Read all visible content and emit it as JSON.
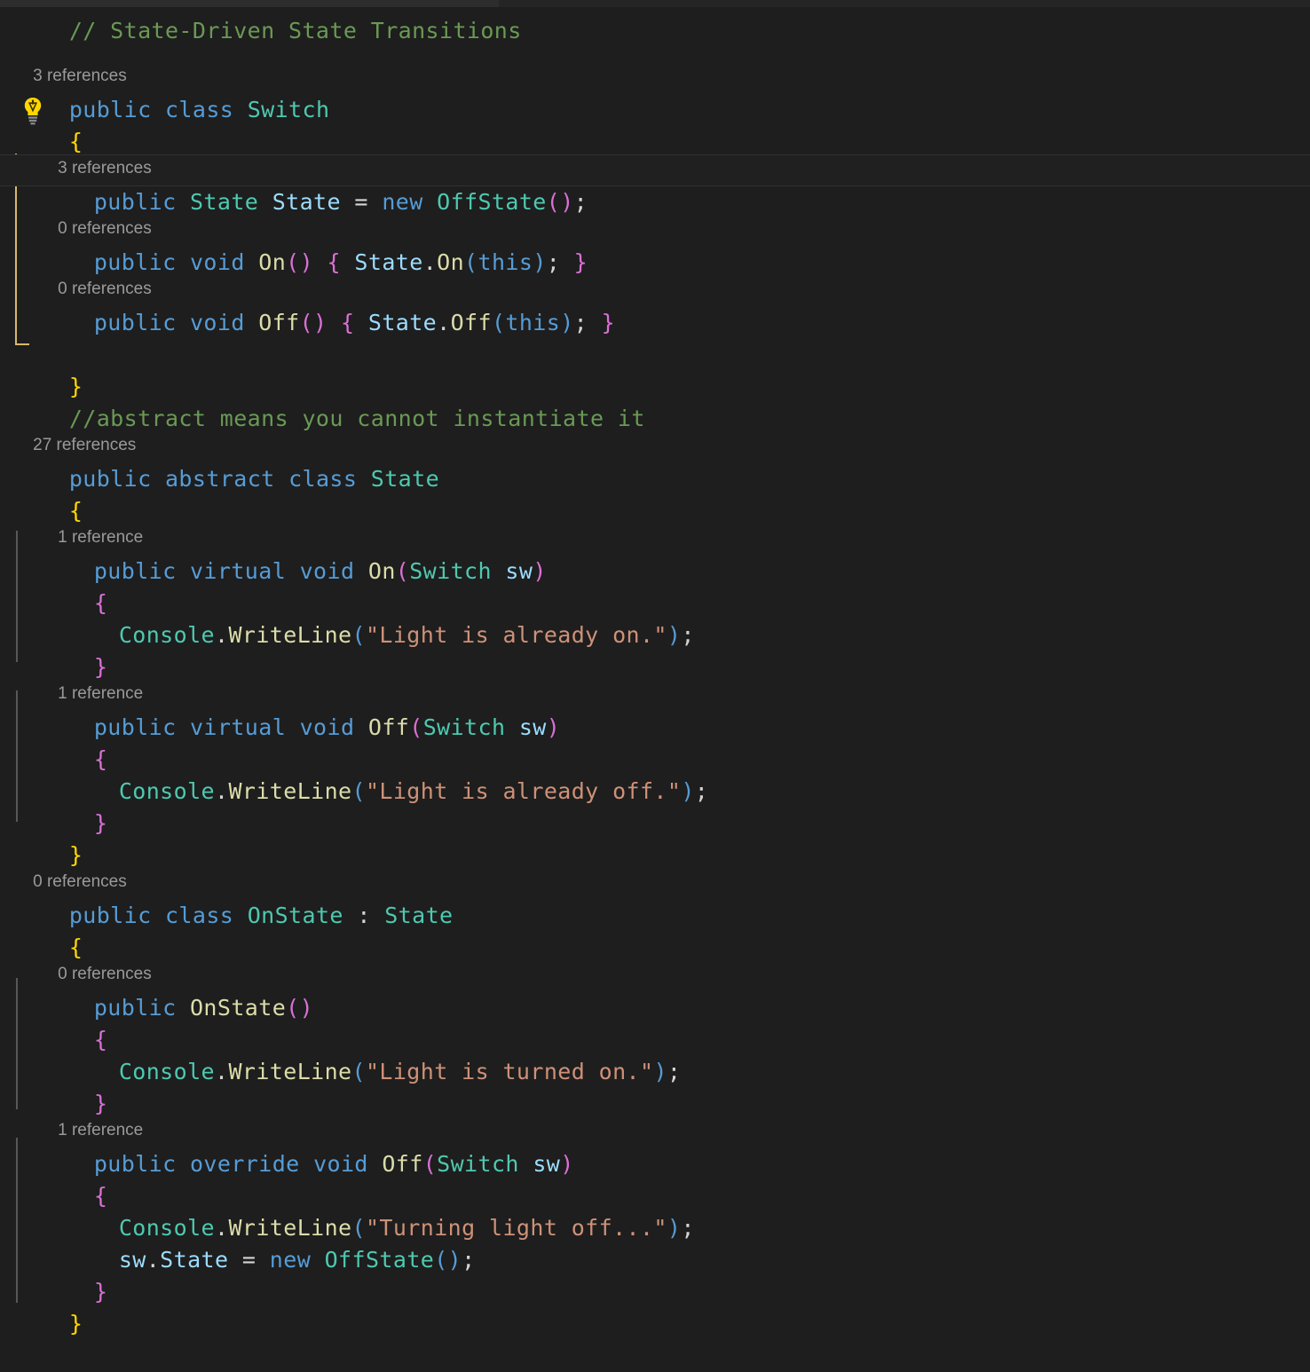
{
  "app": {
    "kind": "code-editor",
    "language": "csharp",
    "theme": "dark-plus"
  },
  "colors": {
    "background": "#1e1e1e",
    "current_line": "#202020",
    "keyword": "#569cd6",
    "type": "#4ec9b0",
    "function": "#dcdcaa",
    "string": "#ce9178",
    "comment": "#6a9955",
    "identifier": "#9cdcfe",
    "brace_magenta": "#da70d6",
    "brace_yellow": "#ffd700",
    "codelens": "#9a9a9a",
    "indent_guide": "#585858",
    "indent_guide_active": "#d7ba6a",
    "lightbulb": "#ffd700"
  },
  "icons": {
    "lightbulb": "lightbulb-icon"
  },
  "codelens": {
    "switch_class": "3 references",
    "switch_state_field": "3 references",
    "switch_on_method": "0 references",
    "switch_off_method": "0 references",
    "state_class": "27 references",
    "state_on_method": "1 reference",
    "state_off_method": "1 reference",
    "onstate_class": "0 references",
    "onstate_ctor": "0 references",
    "onstate_off_method": "1 reference"
  },
  "code": {
    "header_comment": "// State-Driven State Transitions",
    "abstract_comment": "//abstract means you cannot instantiate it",
    "switch_decl": {
      "public": "public",
      "class": "class",
      "name": "Switch"
    },
    "switch_open_brace": "{",
    "switch_close_brace": "}",
    "state_field": {
      "public": "public",
      "type": "State",
      "name": "State",
      "equals": "=",
      "new": "new",
      "ctor": "OffState",
      "parens": "()",
      "semi": ";"
    },
    "switch_on": {
      "public": "public",
      "void": "void",
      "name": "On",
      "parens": "()",
      "open": "{",
      "target": "State",
      "dot": ".",
      "call": "On",
      "lparen": "(",
      "arg": "this",
      "rparen": ")",
      "semi": ";",
      "close": "}"
    },
    "switch_off": {
      "public": "public",
      "void": "void",
      "name": "Off",
      "parens": "()",
      "open": "{",
      "target": "State",
      "dot": ".",
      "call": "Off",
      "lparen": "(",
      "arg": "this",
      "rparen": ")",
      "semi": ";",
      "close": "}"
    },
    "state_decl": {
      "public": "public",
      "abstract": "abstract",
      "class": "class",
      "name": "State"
    },
    "state_open_brace": "{",
    "state_close_brace": "}",
    "state_on": {
      "public": "public",
      "virtual": "virtual",
      "void": "void",
      "name": "On",
      "lparen": "(",
      "param_type": "Switch",
      "param_name": "sw",
      "rparen": ")",
      "open": "{",
      "close": "}",
      "body": {
        "console": "Console",
        "dot": ".",
        "writeline": "WriteLine",
        "lparen": "(",
        "text": "\"Light is already on.\"",
        "rparen": ")",
        "semi": ";"
      }
    },
    "state_off": {
      "public": "public",
      "virtual": "virtual",
      "void": "void",
      "name": "Off",
      "lparen": "(",
      "param_type": "Switch",
      "param_name": "sw",
      "rparen": ")",
      "open": "{",
      "close": "}",
      "body": {
        "console": "Console",
        "dot": ".",
        "writeline": "WriteLine",
        "lparen": "(",
        "text": "\"Light is already off.\"",
        "rparen": ")",
        "semi": ";"
      }
    },
    "onstate_decl": {
      "public": "public",
      "class": "class",
      "name": "OnState",
      "colon": ":",
      "base": "State"
    },
    "onstate_open_brace": "{",
    "onstate_close_brace": "}",
    "onstate_ctor": {
      "public": "public",
      "name": "OnState",
      "parens": "()",
      "open": "{",
      "close": "}",
      "body": {
        "console": "Console",
        "dot": ".",
        "writeline": "WriteLine",
        "lparen": "(",
        "text": "\"Light is turned on.\"",
        "rparen": ")",
        "semi": ";"
      }
    },
    "onstate_off": {
      "public": "public",
      "override": "override",
      "void": "void",
      "name": "Off",
      "lparen": "(",
      "param_type": "Switch",
      "param_name": "sw",
      "rparen": ")",
      "open": "{",
      "close": "}",
      "body_write": {
        "console": "Console",
        "dot": ".",
        "writeline": "WriteLine",
        "lparen": "(",
        "text": "\"Turning light off...\"",
        "rparen": ")",
        "semi": ";"
      },
      "body_assign": {
        "obj": "sw",
        "dot": ".",
        "field": "State",
        "equals": "=",
        "new": "new",
        "ctor": "OffState",
        "parens": "()",
        "semi": ";"
      }
    }
  }
}
